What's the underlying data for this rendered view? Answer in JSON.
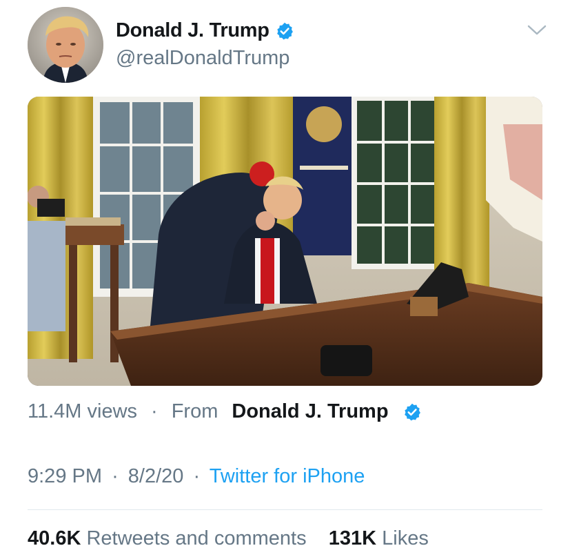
{
  "author": {
    "display_name": "Donald J. Trump",
    "handle": "@realDonaldTrump",
    "verified": true,
    "avatar_icon": "profile-photo"
  },
  "menu": {
    "icon": "chevron-down-icon"
  },
  "media": {
    "type": "video",
    "views": "11.4M views",
    "separator": "·",
    "from_label": "From",
    "from_name": "Donald J. Trump"
  },
  "meta": {
    "time": "9:29 PM",
    "sep1": "·",
    "date": "8/2/20",
    "sep2": "·",
    "source": "Twitter for iPhone"
  },
  "stats": {
    "retweets_count": "40.6K",
    "retweets_label": "Retweets and comments",
    "likes_count": "131K",
    "likes_label": "Likes"
  },
  "colors": {
    "link": "#1da1f2",
    "verified": "#1da1f2",
    "secondary_text": "#657786",
    "primary_text": "#14171a",
    "divider": "#e1e8ed"
  }
}
